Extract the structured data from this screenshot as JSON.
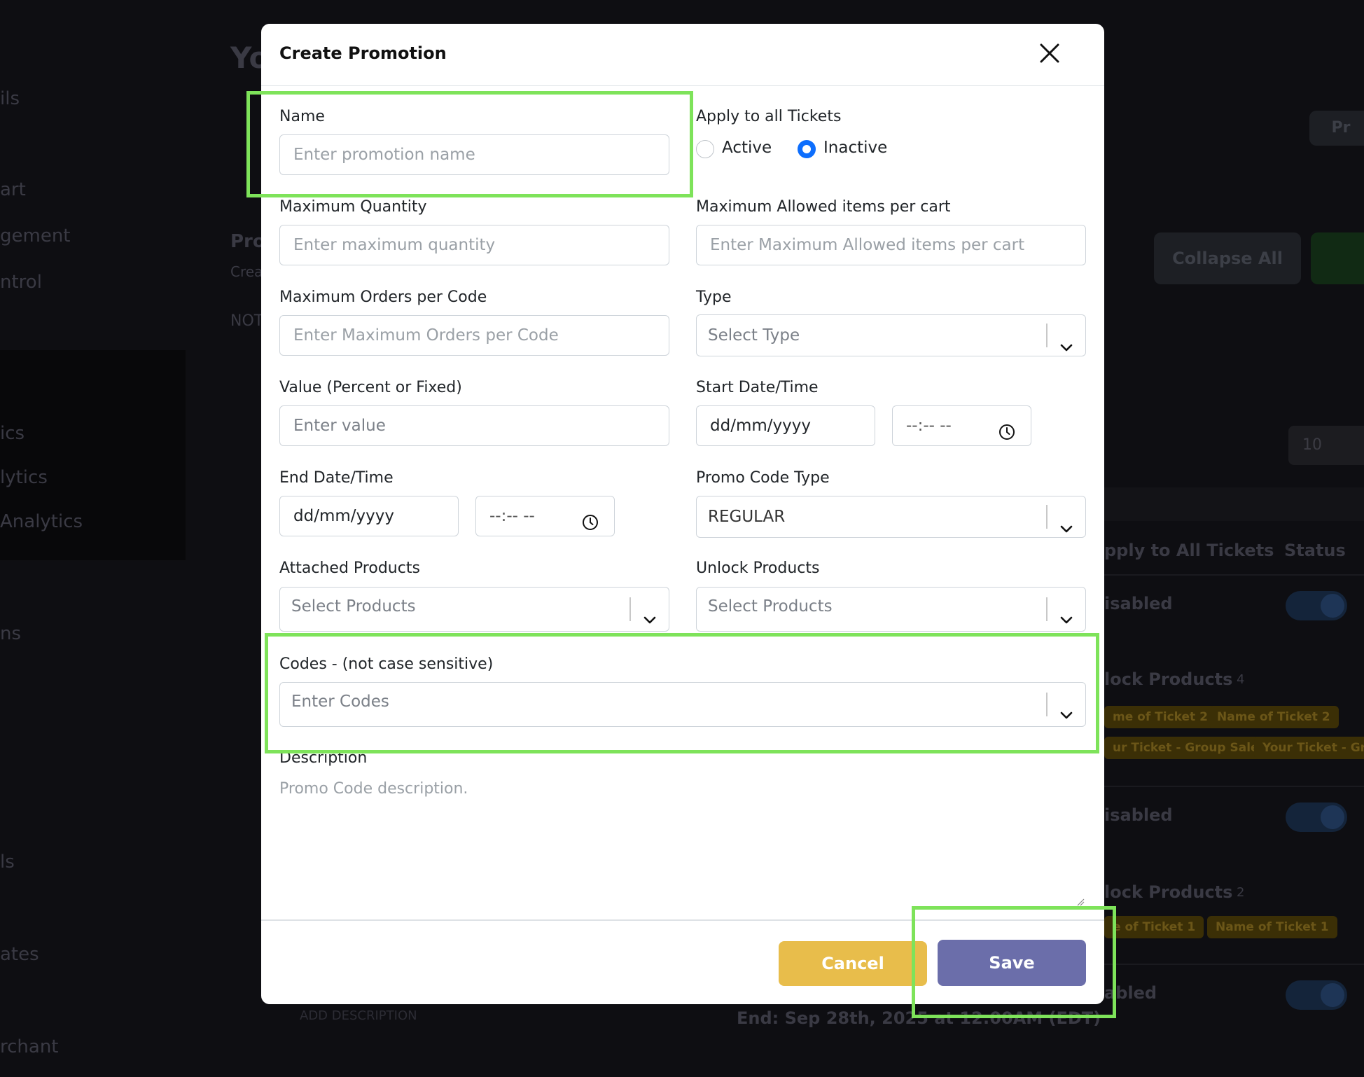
{
  "background": {
    "left_texts": [
      "ils",
      "art",
      "gement",
      "ntrol",
      "ics",
      "lytics",
      "Analytics",
      "ns",
      "ls",
      "ates",
      "rchant"
    ],
    "mid_texts": [
      "Yo",
      "Pro",
      "Crea",
      "NOT"
    ],
    "collapse_all": "Collapse All",
    "page_size": "10",
    "col_apply": "pply to All Tickets",
    "col_status": "Status",
    "row_status": [
      "isabled",
      "isabled",
      "abled"
    ],
    "unlock_products_1": "lock Products",
    "unlock_products_2": "lock Products",
    "count_1": "4",
    "count_2": "2",
    "chips_row1": [
      "me of Ticket 2",
      "Name of Ticket 2"
    ],
    "chips_row2": [
      "ur Ticket - Group Sale",
      "Your Ticket - Gro"
    ],
    "chips_row3": [
      "e of Ticket 1",
      "Name of Ticket 1"
    ],
    "end_text": "End: Sep 28th, 2025 at 12:00AM (EDT)",
    "add_description": "ADD DESCRIPTION",
    "top_right_btn": "Pr"
  },
  "modal": {
    "title": "Create Promotion",
    "name": {
      "label": "Name",
      "placeholder": "Enter promotion name"
    },
    "apply_all": {
      "label": "Apply to all Tickets",
      "options": [
        "Active",
        "Inactive"
      ],
      "selected": "Inactive"
    },
    "max_quantity": {
      "label": "Maximum Quantity",
      "placeholder": "Enter maximum quantity"
    },
    "max_allowed": {
      "label": "Maximum Allowed items per cart",
      "placeholder": "Enter Maximum Allowed items per cart"
    },
    "max_orders": {
      "label": "Maximum Orders per Code",
      "placeholder": "Enter Maximum Orders per Code"
    },
    "type": {
      "label": "Type",
      "placeholder": "Select Type"
    },
    "value": {
      "label": "Value (Percent or Fixed)",
      "placeholder": "Enter value"
    },
    "start": {
      "label": "Start Date/Time",
      "date": "dd/mm/yyyy",
      "time": "--:-- --"
    },
    "end": {
      "label": "End Date/Time",
      "date": "dd/mm/yyyy",
      "time": "--:-- --"
    },
    "promo_code_type": {
      "label": "Promo Code Type",
      "value": "REGULAR"
    },
    "attached_products": {
      "label": "Attached Products",
      "placeholder": "Select Products"
    },
    "unlock_products": {
      "label": "Unlock Products",
      "placeholder": "Select Products"
    },
    "codes": {
      "label": "Codes - (not case sensitive)",
      "placeholder": "Enter Codes"
    },
    "description": {
      "label": "Description",
      "placeholder": "Promo Code description."
    },
    "cancel_label": "Cancel",
    "save_label": "Save"
  },
  "colors": {
    "highlight": "#7ee35a",
    "save": "#6b6eaa",
    "cancel": "#e8bd4b",
    "radio_checked": "#0d6efd"
  }
}
